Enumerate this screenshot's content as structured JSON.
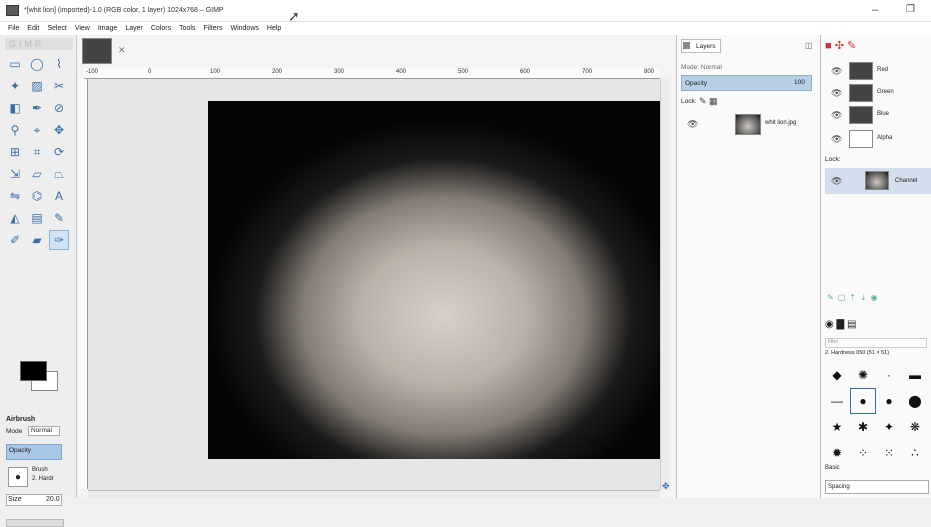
{
  "window": {
    "title": "*[whit lion] (imported)-1.0 (RGB color, 1 layer) 1024x768 – GIMP",
    "minimize": "–",
    "restore": "❐"
  },
  "menu": [
    "File",
    "Edit",
    "Select",
    "View",
    "Image",
    "Layer",
    "Colors",
    "Tools",
    "Filters",
    "Windows",
    "Help"
  ],
  "toolbox": {
    "tools": [
      "rect-select",
      "ellipse-select",
      "free-select",
      "fuzzy-select",
      "by-color-select",
      "scissors",
      "foreground-select",
      "paths",
      "color-picker",
      "zoom",
      "measure",
      "move",
      "align",
      "crop",
      "rotate",
      "scale",
      "shear",
      "perspective",
      "flip",
      "cage",
      "text",
      "bucket-fill",
      "blend",
      "pencil",
      "paintbrush",
      "eraser",
      "airbrush",
      "ink",
      "clone",
      "heal",
      "smudge",
      "dodge-burn",
      "blur",
      "convolve",
      "sharpen",
      "desaturate"
    ],
    "active_tool_index": 26,
    "fg_color": "#000000",
    "bg_color": "#ffffff",
    "options": {
      "tool_name": "Airbrush",
      "mode_label": "Mode",
      "mode_value": "Normal",
      "opacity_label": "Opacity",
      "brush_label": "Brush",
      "brush_name": "2. Hardr",
      "size_label": "Size",
      "size_value": "20.0"
    }
  },
  "image_window": {
    "ruler_labels": [
      "-100",
      "0",
      "100",
      "200",
      "300",
      "400",
      "500",
      "600",
      "700",
      "800"
    ]
  },
  "layers": {
    "tab_label": "Layers",
    "mode": "Mode: Normal",
    "opacity_label": "Opacity",
    "opacity_value": "100",
    "lock_label": "Lock:",
    "layer_name": "whit lion.jpg"
  },
  "channels": {
    "items": [
      {
        "name": "Red",
        "color": "#444444"
      },
      {
        "name": "Green",
        "color": "#444444"
      },
      {
        "name": "Blue",
        "color": "#444444"
      },
      {
        "name": "Alpha",
        "color": "#ffffff"
      }
    ],
    "lock_label": "Lock:",
    "selected_channel": "Channel"
  },
  "brushes": {
    "filter_placeholder": "filter",
    "info": "2. Hardness 050 (51 × 51)",
    "tag_label": "Basic",
    "spacing_label": "Spacing"
  }
}
